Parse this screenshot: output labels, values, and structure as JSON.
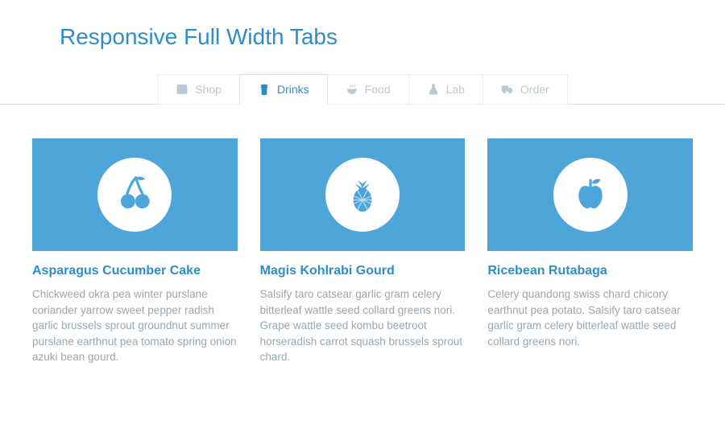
{
  "title": "Responsive Full Width Tabs",
  "tabs": [
    {
      "label": "Shop",
      "icon": "store-icon",
      "active": false
    },
    {
      "label": "Drinks",
      "icon": "cup-icon",
      "active": true
    },
    {
      "label": "Food",
      "icon": "bowl-icon",
      "active": false
    },
    {
      "label": "Lab",
      "icon": "flask-icon",
      "active": false
    },
    {
      "label": "Order",
      "icon": "truck-icon",
      "active": false
    }
  ],
  "cards": [
    {
      "icon": "cherries-icon",
      "title": "Asparagus Cucumber Cake",
      "body": "Chickweed okra pea winter purslane coriander yarrow sweet pepper radish garlic brussels sprout groundnut summer purslane earthnut pea tomato spring onion azuki bean gourd."
    },
    {
      "icon": "pineapple-icon",
      "title": "Magis Kohlrabi Gourd",
      "body": "Salsify taro catsear garlic gram celery bitterleaf wattle seed collard greens nori. Grape wattle seed kombu beetroot horseradish carrot squash brussels sprout chard."
    },
    {
      "icon": "apple-icon",
      "title": "Ricebean Rutabaga",
      "body": "Celery quandong swiss chard chicory earthnut pea potato. Salsify taro catsear garlic gram celery bitterleaf wattle seed collard greens nori."
    }
  ]
}
